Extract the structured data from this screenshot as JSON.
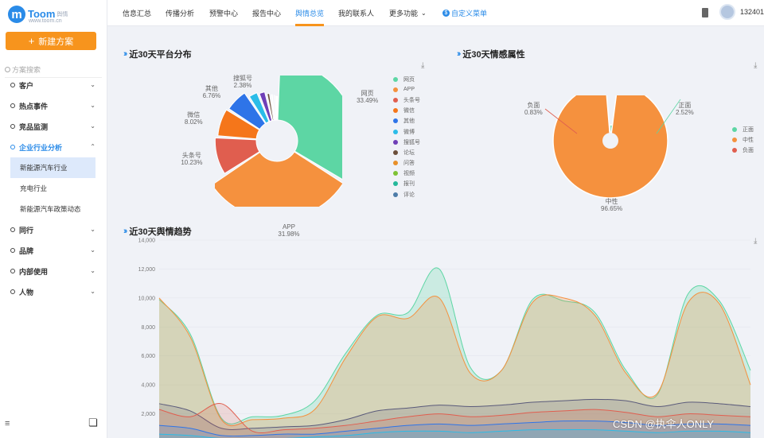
{
  "brand": {
    "name": "Toom",
    "tag": "舆情",
    "url": "www.toom.cn",
    "accent": "#2a8be8",
    "orange": "#f7941d"
  },
  "sidebar": {
    "new_button": "新建方案",
    "search_placeholder": "方案搜索",
    "items": [
      {
        "label": "客户",
        "chevron": "chevron-down-icon"
      },
      {
        "label": "热点事件",
        "chevron": "chevron-down-icon"
      },
      {
        "label": "竞品监测",
        "chevron": "chevron-down-icon"
      },
      {
        "label": "企业行业分析",
        "chevron": "chevron-up-icon"
      }
    ],
    "sub_items": [
      {
        "label": "新能源汽车行业"
      },
      {
        "label": "充电行业"
      },
      {
        "label": "新能源汽车政策动态"
      }
    ],
    "items2": [
      {
        "label": "同行"
      },
      {
        "label": "品牌"
      },
      {
        "label": "内部使用"
      },
      {
        "label": "人物"
      }
    ]
  },
  "topbar": {
    "tabs": [
      "信息汇总",
      "传播分析",
      "预警中心",
      "报告中心",
      "舆情总览",
      "我的联系人",
      "更多功能"
    ],
    "custom_menu": "自定义菜单",
    "user_id": "132401"
  },
  "platform_section": {
    "title": "近30天平台分布"
  },
  "sentiment_section": {
    "title": "近30天情感属性"
  },
  "trend_section": {
    "title": "近30天舆情趋势"
  },
  "chart_data": [
    {
      "type": "pie",
      "title": "近30天平台分布",
      "slices": [
        {
          "name": "网页",
          "value": 33.49,
          "label": "33.49%",
          "color": "#5dd6a4"
        },
        {
          "name": "APP",
          "value": 31.98,
          "label": "31.98%",
          "color": "#f5913e"
        },
        {
          "name": "头条号",
          "value": 10.23,
          "label": "10.23%",
          "color": "#e05e4f"
        },
        {
          "name": "微信",
          "value": 8.02,
          "label": "8.02%",
          "color": "#f5761a"
        },
        {
          "name": "其他",
          "value": 6.76,
          "label": "6.76%",
          "color": "#2e74e8"
        },
        {
          "name": "微博",
          "value": 3.2,
          "color": "#2bbce8"
        },
        {
          "name": "搜狐号",
          "value": 2.38,
          "label": "2.38%",
          "color": "#6f3fb7"
        },
        {
          "name": "论坛",
          "value": 1.4,
          "color": "#6b4f3a"
        },
        {
          "name": "问答",
          "value": 0.9,
          "color": "#e8902a"
        },
        {
          "name": "视频",
          "value": 0.7,
          "color": "#7ec234"
        },
        {
          "name": "报刊",
          "value": 0.5,
          "color": "#25b89a"
        },
        {
          "name": "评论",
          "value": 0.43,
          "color": "#4d7ca8"
        }
      ]
    },
    {
      "type": "pie",
      "title": "近30天情感属性",
      "slices": [
        {
          "name": "正面",
          "value": 2.52,
          "label": "2.52%",
          "color": "#5dd6a4"
        },
        {
          "name": "中性",
          "value": 96.65,
          "label": "96.65%",
          "color": "#f5913e"
        },
        {
          "name": "负面",
          "value": 0.83,
          "label": "0.83%",
          "color": "#e05e4f"
        }
      ]
    },
    {
      "type": "area",
      "title": "近30天舆情趋势",
      "ylim": [
        0,
        14000
      ],
      "yticks": [
        "14,000",
        "12,000",
        "10,000",
        "8,000",
        "6,000",
        "4,000",
        "2,000"
      ],
      "yvalues": [
        14000,
        12000,
        10000,
        8000,
        6000,
        4000,
        2000
      ],
      "series": [
        {
          "color": "#5dd6a4",
          "values": [
            9900,
            7500,
            1700,
            1800,
            1900,
            2900,
            6200,
            8800,
            9000,
            12000,
            5200,
            5000,
            9900,
            9800,
            9000,
            5000,
            3300,
            10300,
            9800,
            5000
          ]
        },
        {
          "color": "#f5913e",
          "values": [
            10000,
            7300,
            1600,
            1600,
            1700,
            2300,
            5900,
            8700,
            8600,
            10000,
            4800,
            5000,
            9700,
            10000,
            8800,
            4800,
            3400,
            9700,
            9600,
            4000
          ]
        },
        {
          "color": "#5a5a7a",
          "values": [
            2700,
            2200,
            1000,
            1000,
            1100,
            1200,
            1600,
            2200,
            2400,
            2600,
            2500,
            2600,
            2800,
            2900,
            3000,
            2900,
            2500,
            2800,
            2700,
            2500
          ]
        },
        {
          "color": "#e05e4f",
          "values": [
            2300,
            1800,
            2700,
            800,
            900,
            1000,
            1200,
            1500,
            1800,
            2000,
            1800,
            1900,
            2100,
            2200,
            2300,
            2100,
            1800,
            2000,
            1900,
            1800
          ]
        },
        {
          "color": "#2e74e8",
          "values": [
            1200,
            1000,
            500,
            500,
            600,
            600,
            800,
            1000,
            1200,
            1300,
            1200,
            1300,
            1400,
            1500,
            1500,
            1400,
            1200,
            1300,
            1300,
            1200
          ]
        },
        {
          "color": "#2bbce8",
          "values": [
            600,
            500,
            300,
            300,
            300,
            400,
            500,
            700,
            800,
            800,
            700,
            800,
            900,
            900,
            900,
            800,
            700,
            800,
            800,
            700
          ]
        }
      ]
    }
  ],
  "watermark": "CSDN @执伞人ONLY"
}
